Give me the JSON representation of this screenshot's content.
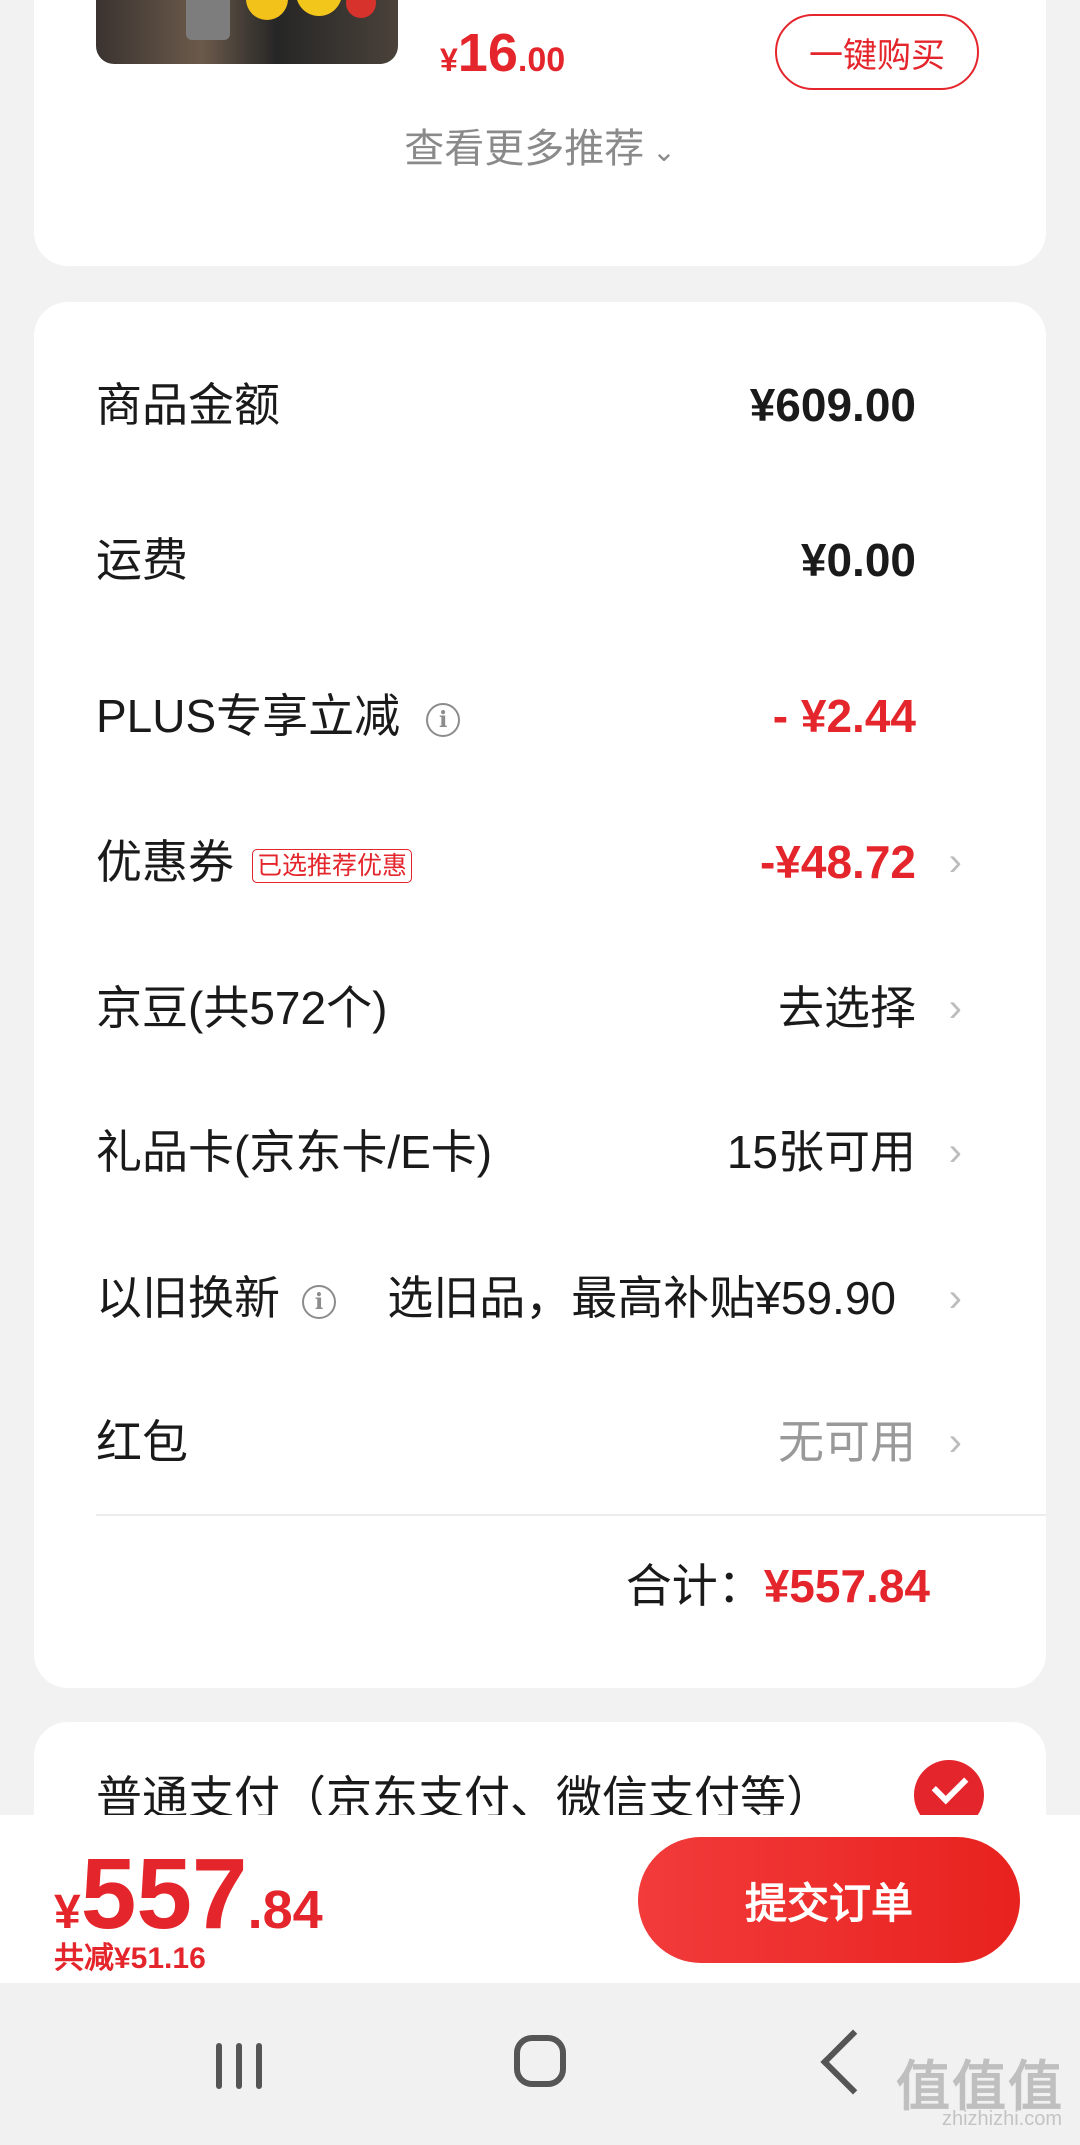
{
  "recommendation": {
    "price_currency": "¥",
    "price_int": "16",
    "price_dec": ".00",
    "buy_button": "一键购买",
    "more_link": "查看更多推荐",
    "more_chevron": "⌄"
  },
  "summary": {
    "rows": [
      {
        "label": "商品金额",
        "value": "¥609.00"
      },
      {
        "label": "运费",
        "value": "¥0.00"
      },
      {
        "label": "PLUS专享立减",
        "value": "- ¥2.44"
      },
      {
        "label": "优惠券",
        "tag": "已选推荐优惠",
        "value": "-¥48.72"
      },
      {
        "label": "京豆(共572个)",
        "value": "去选择"
      },
      {
        "label": "礼品卡(京东卡/E卡)",
        "value": "15张可用"
      },
      {
        "label": "以旧换新",
        "value": "选旧品，最高补贴¥59.90"
      },
      {
        "label": "红包",
        "value": "无可用"
      }
    ],
    "total_label": "合计：",
    "total_value": "¥557.84",
    "info_icon_glyph": "i",
    "arrow_glyph": "›"
  },
  "payment": {
    "method_text": "普通支付（京东支付、微信支付等）"
  },
  "bottom_bar": {
    "price_currency": "¥",
    "price_int": "557",
    "price_dec": ".84",
    "saved_text": "共减¥51.16",
    "submit_label": "提交订单"
  },
  "watermark": {
    "text": "值值值",
    "sub": "zhizhizhi.com"
  },
  "colors": {
    "accent": "#e4252b",
    "background": "#f2f2f2"
  }
}
